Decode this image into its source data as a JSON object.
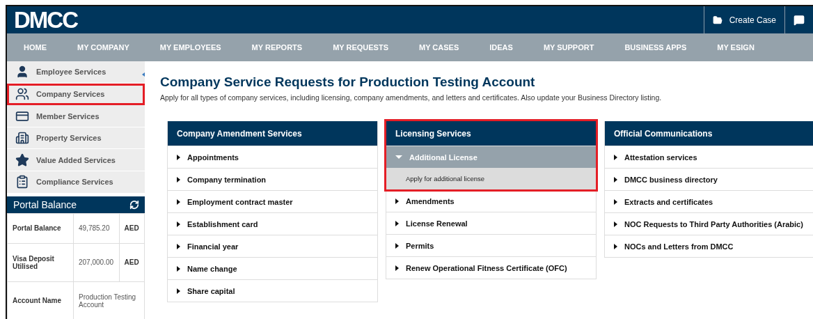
{
  "header": {
    "logo": "DMCC",
    "actions": [
      {
        "kind": "case",
        "label": "Create Case"
      },
      {
        "kind": "chat"
      }
    ]
  },
  "nav": [
    "HOME",
    "MY COMPANY",
    "MY EMPLOYEES",
    "MY REPORTS",
    "MY REQUESTS",
    "MY CASES",
    "IDEAS",
    "MY SUPPORT",
    "BUSINESS APPS",
    "MY ESIGN"
  ],
  "sidebar": {
    "items": [
      {
        "kind": "employee",
        "label": "Employee Services",
        "highlighted": false
      },
      {
        "kind": "company",
        "label": "Company Services",
        "highlighted": true
      },
      {
        "kind": "member",
        "label": "Member Services",
        "highlighted": false
      },
      {
        "kind": "property",
        "label": "Property Services",
        "highlighted": false
      },
      {
        "kind": "value",
        "label": "Value Added Services",
        "highlighted": false
      },
      {
        "kind": "compliance",
        "label": "Compliance Services",
        "highlighted": false
      }
    ],
    "balance": {
      "title": "Portal Balance",
      "rows": [
        {
          "label": "Portal Balance",
          "amount": "49,785.20",
          "currency": "AED"
        },
        {
          "label": "Visa Deposit Utilised",
          "amount": "207,000.00",
          "currency": "AED"
        },
        {
          "label": "Account Name",
          "amount": "Production Testing Account"
        }
      ]
    }
  },
  "page": {
    "title": "Company Service Requests for Production Testing Account",
    "description": "Apply for all types of company services, including licensing, company amendments, and letters and certificates. Also update your Business Directory listing."
  },
  "cards": [
    {
      "title": "Company Amendment Services",
      "highlighted": false,
      "items": [
        {
          "label": "Appointments",
          "expanded": false
        },
        {
          "label": "Company termination",
          "expanded": false
        },
        {
          "label": "Employment contract master",
          "expanded": false
        },
        {
          "label": "Establishment card",
          "expanded": false
        },
        {
          "label": "Financial year",
          "expanded": false
        },
        {
          "label": "Name change",
          "expanded": false
        },
        {
          "label": "Share capital",
          "expanded": false
        }
      ]
    },
    {
      "title": "Licensing Services",
      "highlighted": true,
      "items": [
        {
          "label": "Additional License",
          "expanded": true,
          "detail": "Apply for additional license"
        },
        {
          "label": "Amendments",
          "expanded": false
        },
        {
          "label": "License Renewal",
          "expanded": false
        },
        {
          "label": "Permits",
          "expanded": false
        },
        {
          "label": "Renew Operational Fitness Certificate (OFC)",
          "expanded": false
        }
      ]
    },
    {
      "title": "Official Communications",
      "highlighted": false,
      "items": [
        {
          "label": "Attestation services",
          "expanded": false
        },
        {
          "label": "DMCC business directory",
          "expanded": false
        },
        {
          "label": "Extracts and certificates",
          "expanded": false
        },
        {
          "label": "NOC Requests to Third Party Authorities (Arabic)",
          "expanded": false
        },
        {
          "label": "NOCs and Letters from DMCC",
          "expanded": false
        }
      ]
    }
  ]
}
